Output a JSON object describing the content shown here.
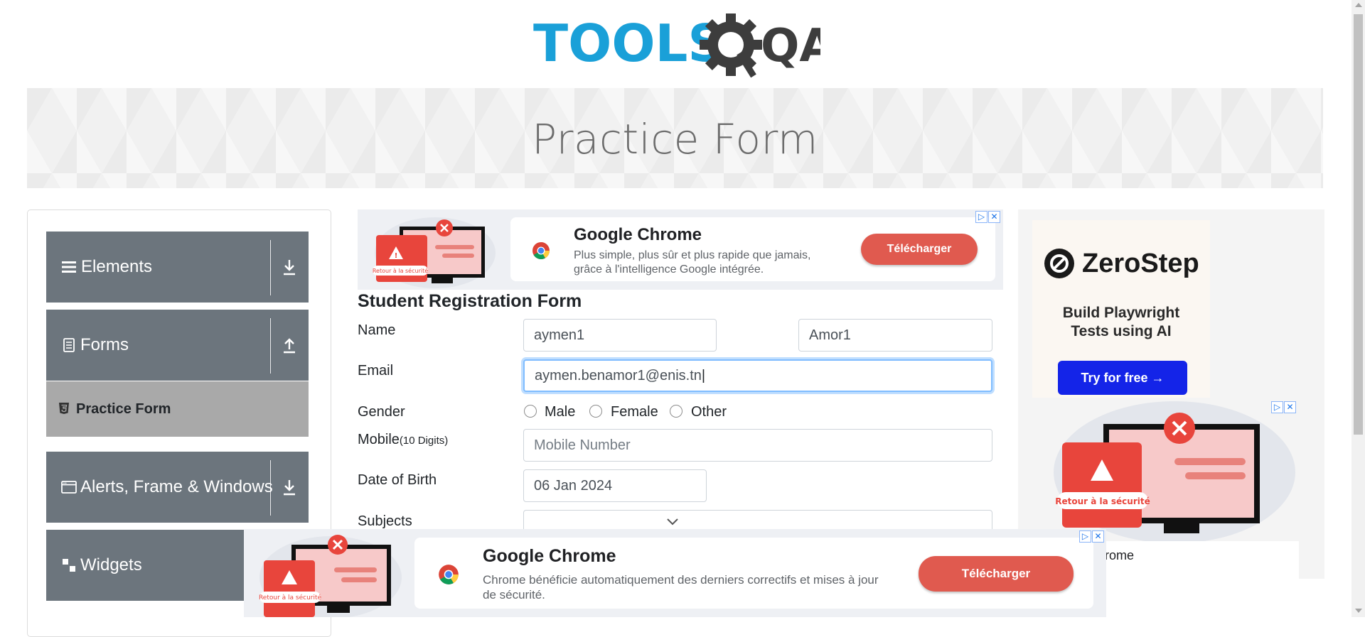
{
  "logo": {
    "text_left": "TOOLS",
    "text_right": "QA"
  },
  "banner": {
    "title": "Practice Form"
  },
  "sidebar": {
    "groups": [
      {
        "label": "Elements",
        "icon": "hamburger-icon",
        "state": "collapsed"
      },
      {
        "label": "Forms",
        "icon": "document-icon",
        "state": "expanded"
      },
      {
        "label": "Alerts, Frame & Windows",
        "icon": "window-icon",
        "state": "collapsed"
      },
      {
        "label": "Widgets",
        "icon": "widget-icon",
        "state": "collapsed"
      }
    ],
    "active_item": {
      "label": "Practice Form",
      "icon": "html5-icon"
    }
  },
  "ad_top": {
    "title": "Google Chrome",
    "desc_line1": "Plus simple, plus sûr et plus rapide que jamais,",
    "desc_line2": "grâce à l'intelligence Google intégrée.",
    "button": "Télécharger",
    "alert_text": "Retour à la sécurité"
  },
  "form": {
    "title": "Student Registration Form",
    "name_label": "Name",
    "first_name": "aymen1",
    "last_name": "Amor1",
    "email_label": "Email",
    "email_value": "aymen.benamor1@enis.tn",
    "gender_label": "Gender",
    "gender_options": [
      "Male",
      "Female",
      "Other"
    ],
    "mobile_label": "Mobile",
    "mobile_hint": "(10 Digits)",
    "mobile_placeholder": "Mobile Number",
    "dob_label": "Date of Birth",
    "dob_value": "06 Jan 2024",
    "subjects_label": "Subjects"
  },
  "ad_right": {
    "brand": "ZeroStep",
    "tagline_line1": "Build Playwright",
    "tagline_line2": "Tests using AI",
    "button": "Try for free →",
    "alert_text": "Retour à la sécurité",
    "footer_text": "rome"
  },
  "ad_bottom": {
    "title": "Google Chrome",
    "desc_line1": "Chrome bénéficie automatiquement des derniers correctifs et mises à jour",
    "desc_line2": "de sécurité.",
    "button": "Télécharger",
    "alert_text": "Retour à la sécurité"
  },
  "colors": {
    "sidebar_group": "#6c757d",
    "sidebar_active": "#a9a9a9",
    "brand_blue": "#1aa0d8",
    "ad_button": "#e05a4f",
    "zerostep_button": "#1424e8"
  }
}
